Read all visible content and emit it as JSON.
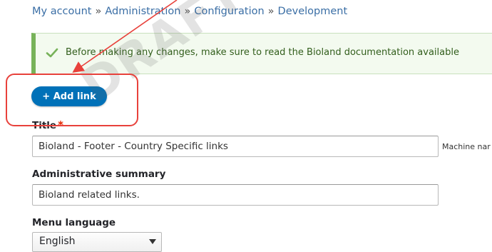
{
  "breadcrumb": {
    "items": [
      "My account",
      "Administration",
      "Configuration",
      "Development"
    ],
    "separator": "»"
  },
  "message": {
    "text": "Before making any changes, make sure to read the Bioland documentation available",
    "icon": "check-icon",
    "status_color": "#77b259"
  },
  "actions": {
    "add_link_label": "+ Add link"
  },
  "form": {
    "title_label": "Title",
    "required_marker": "*",
    "title_value": "Bioland - Footer - Country Specific links",
    "machine_name_label": "Machine nar",
    "summary_label": "Administrative summary",
    "summary_value": "Bioland related links.",
    "language_label": "Menu language",
    "language_value": "English"
  },
  "annotation": {
    "watermark": "DRAFT",
    "color": "#e8413b"
  }
}
